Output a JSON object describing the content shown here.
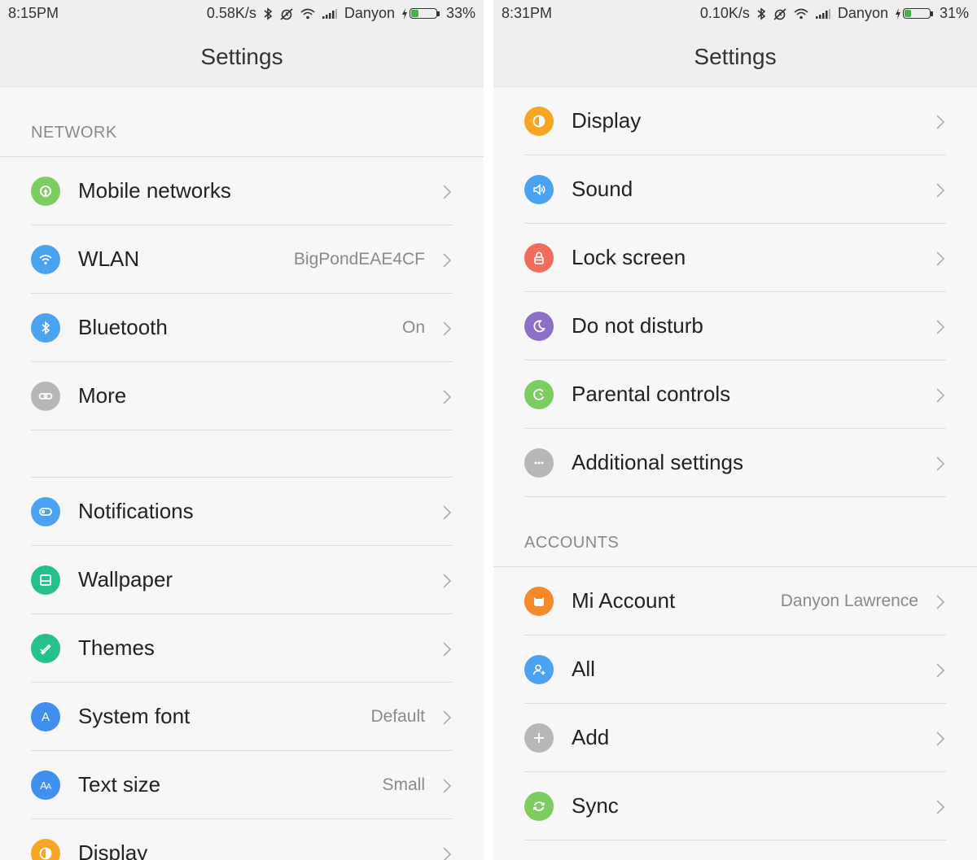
{
  "left": {
    "status": {
      "time": "8:15PM",
      "speed": "0.58K/s",
      "carrier": "Danyon",
      "battery": "33%",
      "battery_level": 0.33
    },
    "title": "Settings",
    "section_network": "NETWORK",
    "network_items": [
      {
        "label": "Mobile networks",
        "value": "",
        "icon": "mobile-networks-icon",
        "color": "#7ccd5f"
      },
      {
        "label": "WLAN",
        "value": "BigPondEAE4CF",
        "icon": "wifi-icon",
        "color": "#4aa3f0"
      },
      {
        "label": "Bluetooth",
        "value": "On",
        "icon": "bluetooth-icon",
        "color": "#4aa3f0"
      },
      {
        "label": "More",
        "value": "",
        "icon": "link-icon",
        "color": "#b7b7b7"
      }
    ],
    "personal_items": [
      {
        "label": "Notifications",
        "value": "",
        "icon": "toggle-icon",
        "color": "#4aa3f0"
      },
      {
        "label": "Wallpaper",
        "value": "",
        "icon": "wallpaper-icon",
        "color": "#25c08c"
      },
      {
        "label": "Themes",
        "value": "",
        "icon": "brush-icon",
        "color": "#25c08c"
      },
      {
        "label": "System font",
        "value": "Default",
        "icon": "font-icon",
        "color": "#3f8ff0"
      },
      {
        "label": "Text size",
        "value": "Small",
        "icon": "text-size-icon",
        "color": "#3f8ff0"
      },
      {
        "label": "Display",
        "value": "",
        "icon": "display-icon",
        "color": "#f6a623"
      }
    ]
  },
  "right": {
    "status": {
      "time": "8:31PM",
      "speed": "0.10K/s",
      "carrier": "Danyon",
      "battery": "31%",
      "battery_level": 0.31
    },
    "title": "Settings",
    "device_items": [
      {
        "label": "Display",
        "value": "",
        "icon": "display-icon",
        "color": "#f6a623"
      },
      {
        "label": "Sound",
        "value": "",
        "icon": "speaker-icon",
        "color": "#4aa3f0"
      },
      {
        "label": "Lock screen",
        "value": "",
        "icon": "lock-icon",
        "color": "#f26b5b"
      },
      {
        "label": "Do not disturb",
        "value": "",
        "icon": "moon-icon",
        "color": "#8b6fc8"
      },
      {
        "label": "Parental controls",
        "value": "",
        "icon": "parental-icon",
        "color": "#7ccd5f"
      },
      {
        "label": "Additional settings",
        "value": "",
        "icon": "dots-icon",
        "color": "#b7b7b7"
      }
    ],
    "section_accounts": "ACCOUNTS",
    "account_items": [
      {
        "label": "Mi Account",
        "value": "Danyon Lawrence",
        "icon": "mi-account-icon",
        "color": "#f6892a"
      },
      {
        "label": "All",
        "value": "",
        "icon": "user-add-icon",
        "color": "#4aa3f0"
      },
      {
        "label": "Add",
        "value": "",
        "icon": "plus-icon",
        "color": "#b7b7b7"
      },
      {
        "label": "Sync",
        "value": "",
        "icon": "sync-icon",
        "color": "#7ccd5f"
      }
    ]
  }
}
